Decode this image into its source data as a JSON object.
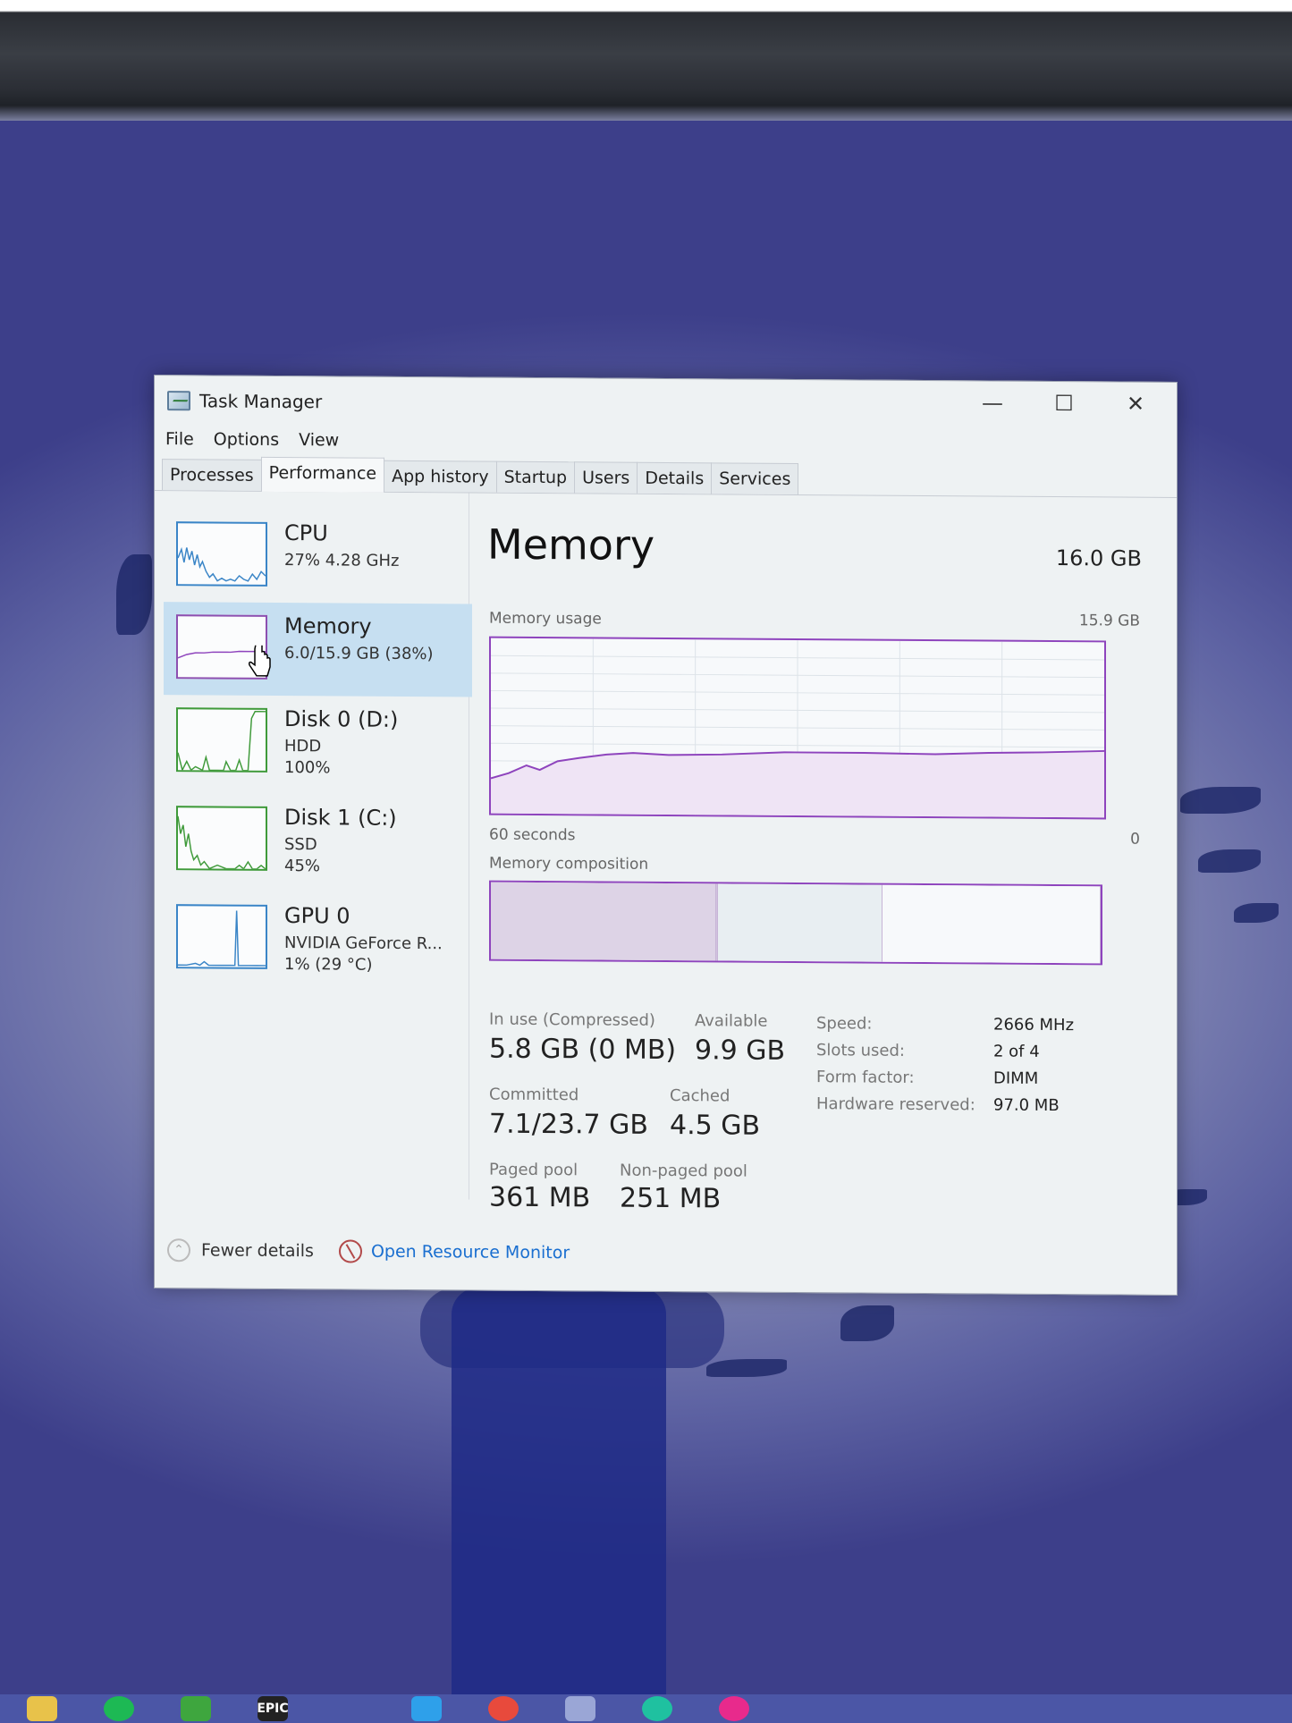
{
  "window": {
    "title": "Task Manager",
    "controls": {
      "minimize": "—",
      "maximize": "☐",
      "close": "✕"
    }
  },
  "menu": [
    "File",
    "Options",
    "View"
  ],
  "tabs": [
    "Processes",
    "Performance",
    "App history",
    "Startup",
    "Users",
    "Details",
    "Services"
  ],
  "active_tab": "Performance",
  "resources": [
    {
      "name": "CPU",
      "line1": "27% 4.28 GHz",
      "line2": "",
      "line3": ""
    },
    {
      "name": "Memory",
      "line1": "6.0/15.9 GB (38%)",
      "line2": "",
      "line3": ""
    },
    {
      "name": "Disk 0 (D:)",
      "line1": "HDD",
      "line2": "100%",
      "line3": ""
    },
    {
      "name": "Disk 1 (C:)",
      "line1": "SSD",
      "line2": "45%",
      "line3": ""
    },
    {
      "name": "GPU 0",
      "line1": "NVIDIA GeForce R...",
      "line2": "1%  (29 °C)",
      "line3": ""
    }
  ],
  "selected_resource": "Memory",
  "detail": {
    "heading": "Memory",
    "total": "16.0 GB",
    "usage_label": "Memory usage",
    "usage_max": "15.9 GB",
    "time_label": "60 seconds",
    "time_end": "0",
    "composition_label": "Memory composition",
    "composition": [
      {
        "part": "in use",
        "fraction": 0.37
      },
      {
        "part": "modified",
        "fraction": 0.003
      },
      {
        "part": "standby",
        "fraction": 0.27
      },
      {
        "part": "free",
        "fraction": 0.357
      }
    ],
    "usage_fraction": 0.38,
    "stats": {
      "in_use_label": "In use (Compressed)",
      "in_use": "5.8 GB (0 MB)",
      "available_label": "Available",
      "available": "9.9 GB",
      "committed_label": "Committed",
      "committed": "7.1/23.7 GB",
      "cached_label": "Cached",
      "cached": "4.5 GB",
      "paged_label": "Paged pool",
      "paged": "361 MB",
      "nonpaged_label": "Non-paged pool",
      "nonpaged": "251 MB"
    },
    "specs": {
      "speed_label": "Speed:",
      "speed": "2666 MHz",
      "slots_label": "Slots used:",
      "slots": "2 of 4",
      "form_label": "Form factor:",
      "form": "DIMM",
      "reserved_label": "Hardware reserved:",
      "reserved": "97.0 MB"
    }
  },
  "footer": {
    "fewer_details": "Fewer details",
    "open_monitor": "Open Resource Monitor"
  },
  "taskbar": {
    "epic_label": "EPIC"
  },
  "colors": {
    "memory_accent": "#8e44bd",
    "cpu_accent": "#3a85c7",
    "disk_accent": "#3f9a3a",
    "selection": "#c6dff1",
    "link": "#1a6fd0"
  }
}
